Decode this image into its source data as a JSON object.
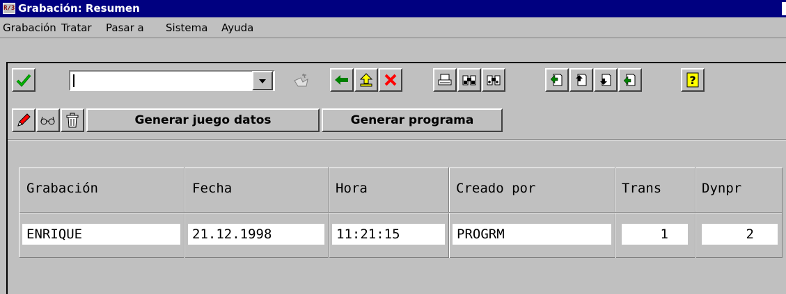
{
  "window": {
    "title": "Grabación: Resumen",
    "app_icon_text": "R/3"
  },
  "menu": [
    "Grabación",
    "Tratar",
    "Pasar a",
    "Sistema",
    "Ayuda"
  ],
  "toolbar": {
    "command_field_value": "",
    "icons": [
      "check-icon",
      "dropdown-arrow-icon",
      "save-icon",
      "back-arrow-icon",
      "exit-up-icon",
      "cancel-x-icon",
      "print-icon",
      "find-icon",
      "find-next-icon",
      "first-page-icon",
      "previous-page-icon",
      "next-page-icon",
      "last-page-icon",
      "help-icon"
    ]
  },
  "app_toolbar": {
    "icons": [
      "pencil-icon",
      "glasses-icon",
      "trash-icon"
    ],
    "generate_dataset_label": "Generar juego datos",
    "generate_program_label": "Generar programa"
  },
  "table": {
    "columns": [
      "Grabación",
      "Fecha",
      "Hora",
      "Creado por",
      "Trans",
      "Dynpr"
    ],
    "rows": [
      [
        "ENRIQUE",
        "21.12.1998",
        "11:21:15",
        "PROGRM",
        "1",
        "2"
      ]
    ]
  },
  "colors": {
    "title_bar": "#000080",
    "window_bg": "#c0c0c0",
    "check_green": "#008000",
    "cancel_red": "#ff0000",
    "help_yellow": "#ffff00"
  }
}
